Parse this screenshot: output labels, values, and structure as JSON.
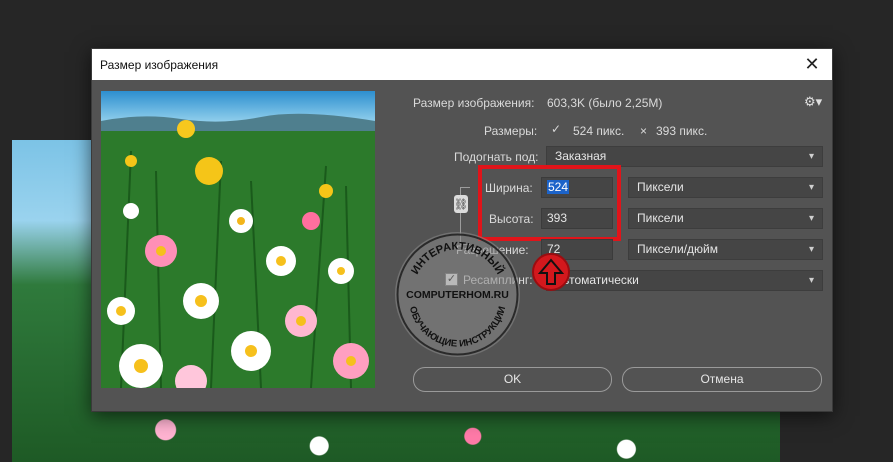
{
  "dialog": {
    "title": "Размер изображения",
    "close_glyph": "✕"
  },
  "info": {
    "size_label": "Размер изображения:",
    "size_value": "603,3K (было 2,25M)",
    "dims_label": "Размеры:",
    "dims_width": "524 пикс.",
    "dims_x": "×",
    "dims_height": "393 пикс.",
    "settings_icon": "gear-icon"
  },
  "fit": {
    "label": "Подогнать под:",
    "value": "Заказная"
  },
  "width": {
    "label": "Ширина:",
    "value": "524",
    "unit": "Пиксели"
  },
  "height": {
    "label": "Высота:",
    "value": "393",
    "unit": "Пиксели"
  },
  "resolution": {
    "label": "Разрешение:",
    "value": "72",
    "unit": "Пиксели/дюйм"
  },
  "resample": {
    "label": "Ресамплинг:",
    "checked": true,
    "value": "Автоматически"
  },
  "buttons": {
    "ok": "OK",
    "cancel": "Отмена"
  },
  "watermark": {
    "top": "ИНТЕРАКТИВНЫЙ",
    "middle": "COMPUTERHOM.RU",
    "bottom": "ОБУЧАЮЩИЕ ИНСТРУКЦИИ"
  },
  "colors": {
    "dialog_bg": "#535353",
    "highlight": "#e0141a",
    "selection": "#1c63c9"
  }
}
